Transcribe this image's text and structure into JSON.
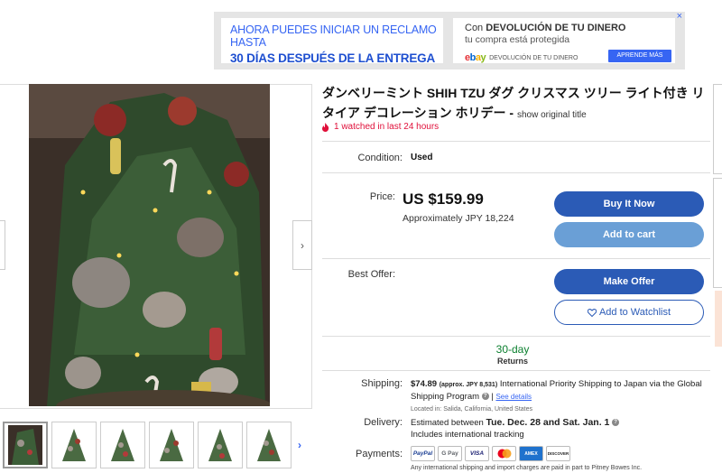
{
  "ad": {
    "left_line1": "AHORA PUEDES INICIAR UN RECLAMO HASTA",
    "left_line2": "30 DÍAS DESPUÉS DE LA ENTREGA",
    "right_line1_prefix": "Con ",
    "right_line1_bold": "DEVOLUCIÓN DE TU DINERO",
    "right_line2": "tu compra está protegida",
    "right_line3": "DEVOLUCIÓN DE TU DINERO",
    "button": "APRENDE MÁS",
    "close": "×",
    "logo": {
      "e": "e",
      "b": "b",
      "a": "a",
      "y": "y"
    }
  },
  "gallery": {
    "next_arrow": "›",
    "thumb_next": "›",
    "thumb_count": 6
  },
  "listing": {
    "title": "ダンベリーミント SHIH TZU ダグ クリスマス ツリー ライト付き リタイア デコレーション ホリデー - ",
    "show_original": "show original title",
    "watched": "1 watched in last 24 hours",
    "condition_label": "Condition:",
    "condition_value": "Used",
    "price_label": "Price:",
    "price": "US $159.99",
    "approx_prefix": "Approximately ",
    "approx_value": "JPY 18,224",
    "buy_now": "Buy It Now",
    "add_to_cart": "Add to cart",
    "best_offer_label": "Best Offer:",
    "make_offer": "Make Offer",
    "add_watchlist": "Add to Watchlist",
    "returns_days": "30-day",
    "returns_label": "Returns",
    "shipping_label": "Shipping:",
    "shipping_price": "$74.89",
    "shipping_approx": "(approx. JPY 8,531)",
    "shipping_text": "International Priority Shipping to Japan via the Global Shipping Program",
    "see_details": "See details",
    "located_in": "Located in:  Salida, California, United States",
    "delivery_label": "Delivery:",
    "delivery_prefix": "Estimated between ",
    "delivery_dates": "Tue. Dec. 28 and Sat. Jan. 1",
    "delivery_line2": "Includes international tracking",
    "payments_label": "Payments:",
    "payment_cards": [
      "PayPal",
      "G Pay",
      "VISA",
      "MC",
      "AMEX",
      "DISCOVER"
    ],
    "payments_note": "Any international shipping and import charges are paid in part to Pitney Bowes Inc."
  },
  "colors": {
    "accent_blue": "#2b5bb6",
    "cart_blue": "#6a9fd6",
    "watched_red": "#e0103a",
    "returns_green": "#0a7f2e"
  }
}
